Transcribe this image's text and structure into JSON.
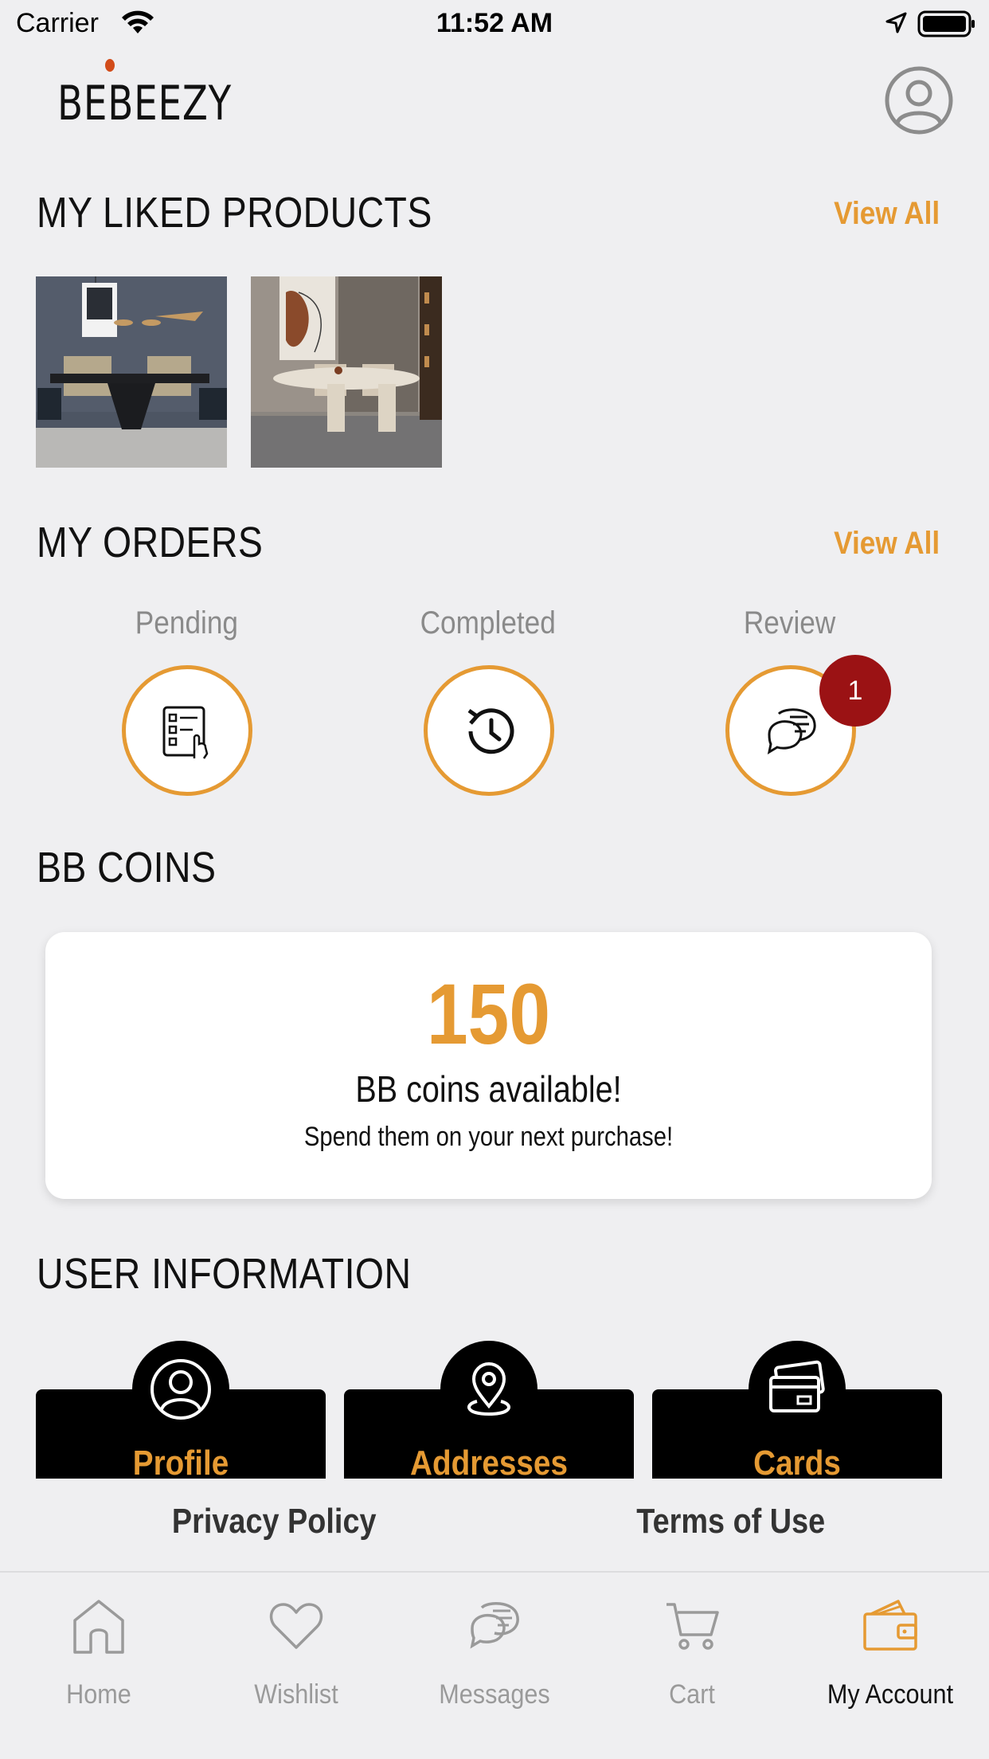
{
  "status_bar": {
    "carrier": "Carrier",
    "time": "11:52 AM"
  },
  "header": {
    "logo_text": "BEBEEZY"
  },
  "liked_products": {
    "title": "MY LIKED PRODUCTS",
    "view_all": "View All"
  },
  "orders": {
    "title": "MY ORDERS",
    "view_all": "View All",
    "items": [
      {
        "label": "Pending",
        "icon": "checklist-icon"
      },
      {
        "label": "Completed",
        "icon": "history-icon"
      },
      {
        "label": "Review",
        "icon": "chat-bubble-icon",
        "badge": "1"
      }
    ]
  },
  "coins": {
    "title": "BB COINS",
    "value": "150",
    "available_text": "BB coins available!",
    "spend_text": "Spend them on your next purchase!"
  },
  "user_information": {
    "title": "USER INFORMATION",
    "cards": [
      {
        "label": "Profile",
        "icon": "user-icon"
      },
      {
        "label": "Addresses",
        "icon": "location-pin-icon"
      },
      {
        "label": "Cards",
        "icon": "credit-card-icon"
      }
    ]
  },
  "footer": {
    "privacy": "Privacy Policy",
    "terms": "Terms of Use"
  },
  "tab_bar": {
    "items": [
      {
        "label": "Home",
        "icon": "home-icon"
      },
      {
        "label": "Wishlist",
        "icon": "heart-icon"
      },
      {
        "label": "Messages",
        "icon": "message-icon"
      },
      {
        "label": "Cart",
        "icon": "cart-icon"
      },
      {
        "label": "My Account",
        "icon": "wallet-icon",
        "active": true
      }
    ]
  },
  "colors": {
    "accent": "#e59a33",
    "badge": "#9b1214",
    "background": "#efeff1"
  }
}
